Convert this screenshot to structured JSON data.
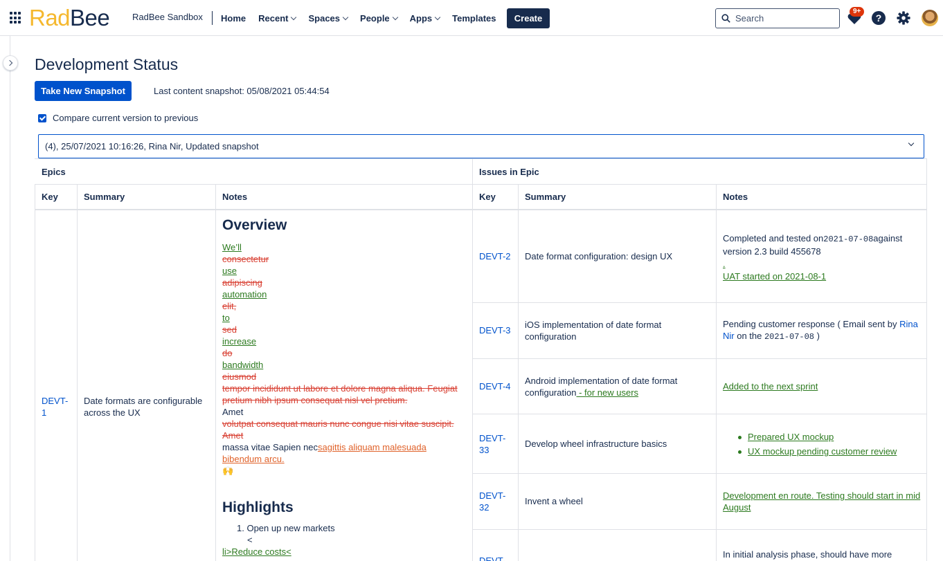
{
  "app": {
    "logo_left": "Rad",
    "logo_right": "Bee",
    "space_name": "RadBee Sandbox"
  },
  "nav": {
    "home": "Home",
    "recent": "Recent",
    "spaces": "Spaces",
    "people": "People",
    "apps": "Apps",
    "templates": "Templates",
    "create": "Create",
    "search_placeholder": "Search",
    "notification_count": "9+",
    "help_glyph": "?"
  },
  "page": {
    "title": "Development Status",
    "snapshot_button": "Take New Snapshot",
    "snapshot_info": "Last content snapshot: 05/08/2021 05:44:54",
    "compare_label": "Compare current version to previous",
    "compare_checked": true,
    "version_selected": "(4), 25/07/2021 10:16:26, Rina Nir, Updated snapshot"
  },
  "table": {
    "group_epics": "Epics",
    "group_issues": "Issues in Epic",
    "epic_headers": [
      "Key",
      "Summary",
      "Notes"
    ],
    "issue_headers": [
      "Key",
      "Summary",
      "Notes"
    ],
    "epic": {
      "key": "DEVT-1",
      "summary": "Date formats are configurable across the UX",
      "overview_title": "Overview",
      "overview_lines": [
        {
          "text": "We’ll",
          "style": "ins"
        },
        {
          "text": "consectetur",
          "style": "del"
        },
        {
          "text": "use",
          "style": "ins"
        },
        {
          "text": "adipiscing",
          "style": "del"
        },
        {
          "text": "automation",
          "style": "ins"
        },
        {
          "text": "elit,",
          "style": "del"
        },
        {
          "text": "to",
          "style": "ins"
        },
        {
          "text": "sed",
          "style": "del"
        },
        {
          "text": "increase",
          "style": "ins"
        },
        {
          "text": "do",
          "style": "del"
        },
        {
          "text": "bandwidth",
          "style": "ins"
        },
        {
          "text": "eiusmod",
          "style": "del"
        }
      ],
      "overview_para1": "tempor incididunt ut labore et dolore magna aliqua. Feugiat pretium nibh ipsum consequat nisl vel pretium.",
      "overview_amet": "Amet",
      "overview_para2": "volutpat consequat mauris nunc congue nisi vitae suscipit. Amet",
      "overview_para3_plain": "massa vitae Sapien nec",
      "overview_para3_changed": "sagittis aliquam malesuada bibendum arcu.",
      "overview_emoji": "🙌",
      "highlights_title": "Highlights",
      "highlight_item": "1. Open up new markets",
      "highlight_stray": "<",
      "highlight_fragment": "li>Reduce costs<"
    },
    "issues": [
      {
        "key": "DEVT-2",
        "summary": "Date format configuration: design UX",
        "notes_plain_1": "Completed and tested on",
        "notes_date": "2021-07-08",
        "notes_plain_2": "against version 2.3 build 455678",
        "notes_dot": ".",
        "notes_added": "UAT started on 2021-08-1"
      },
      {
        "key": "DEVT-3",
        "summary": "iOS implementation of date format configuration",
        "notes_plain_1": "Pending customer response ( Email sent by ",
        "notes_person": "Rina Nir",
        "notes_plain_2": " on the ",
        "notes_date": "2021-07-08",
        "notes_plain_3": " )"
      },
      {
        "key": "DEVT-4",
        "summary": "Android implementation of date format configuration",
        "summary_added": " - for new users",
        "notes_added": "Added to the next sprint"
      },
      {
        "key": "DEVT-33",
        "summary": "Develop wheel infrastructure basics",
        "notes_items": [
          "Prepared UX mockup",
          "UX mockup pending customer review"
        ]
      },
      {
        "key": "DEVT-32",
        "summary": "Invent a wheel",
        "notes_added": "Development en route. Testing should start in mid August"
      },
      {
        "key": "DEVT-",
        "summary": "",
        "notes_plain": "In initial analysis phase, should have more"
      }
    ]
  },
  "colors": {
    "primary": "#0052cc",
    "text": "#172b4d",
    "inserted": "#2c7a1f",
    "deleted": "#d94235",
    "changed": "#e0622a",
    "badge": "#de350b",
    "logo_accent": "#f5b82e"
  }
}
